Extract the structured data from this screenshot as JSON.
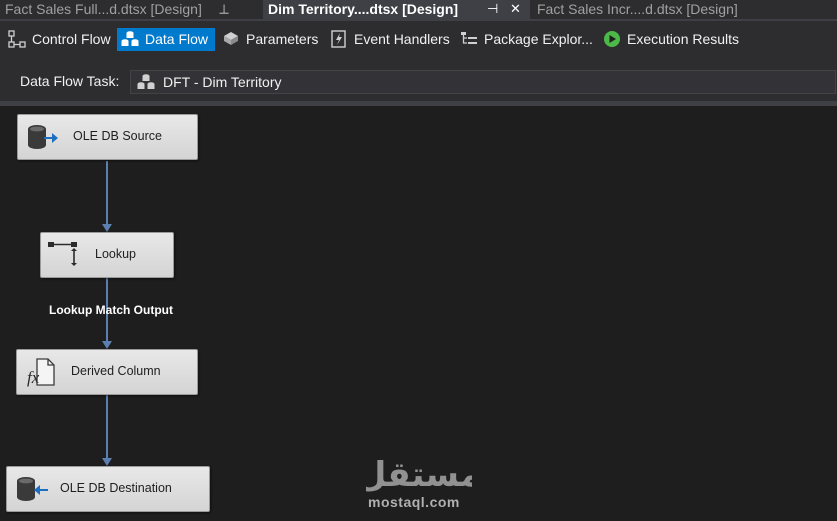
{
  "document_tabs": [
    {
      "label": "Fact Sales Full...d.dtsx [Design]",
      "active": false
    },
    {
      "label": "Dim Territory....dtsx [Design]",
      "active": true
    },
    {
      "label": "Fact Sales Incr....d.dtsx [Design]",
      "active": false
    }
  ],
  "tab_glyphs": {
    "pin": "⊣",
    "close": "✕"
  },
  "designer_tabs": [
    {
      "label": "Control Flow",
      "icon": "control-flow-icon"
    },
    {
      "label": "Data Flow",
      "icon": "data-flow-icon",
      "selected": true
    },
    {
      "label": "Parameters",
      "icon": "parameters-icon"
    },
    {
      "label": "Event Handlers",
      "icon": "event-handlers-icon"
    },
    {
      "label": "Package Explor...",
      "icon": "package-explorer-icon"
    },
    {
      "label": "Execution Results",
      "icon": "execution-results-icon"
    }
  ],
  "task_selector": {
    "label": "Data Flow Task:",
    "value": "DFT - Dim Territory"
  },
  "components": [
    {
      "label": "OLE DB Source",
      "icon": "ole-db-source-icon"
    },
    {
      "label": "Lookup",
      "icon": "lookup-icon"
    },
    {
      "label": "Derived Column",
      "icon": "derived-column-icon"
    },
    {
      "label": "OLE DB Destination",
      "icon": "ole-db-destination-icon"
    }
  ],
  "path_label": "Lookup Match Output",
  "watermark": {
    "logo_text": "مستقل",
    "site": "mostaql.com"
  },
  "colors": {
    "accent": "#007acc",
    "connector": "#5b7fae",
    "execute_green": "#4cb848"
  }
}
